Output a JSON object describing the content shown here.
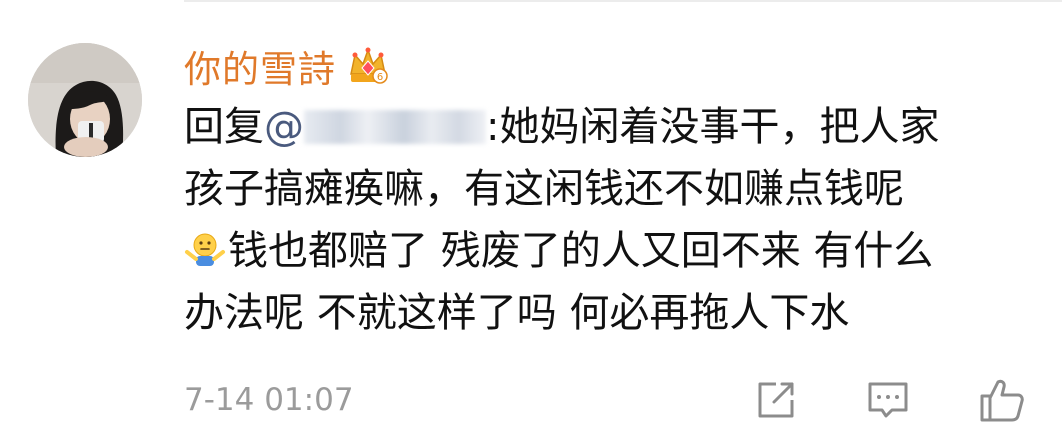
{
  "comment": {
    "username": "你的雪詩",
    "username_color": "#e0792a",
    "vip_badge_icon": "crown-vip-badge-icon",
    "reply_prefix": "回复",
    "mention_at": "@",
    "mention_redacted": true,
    "body_line_1": ":她妈闲着没事干，把人家",
    "body_line_2": "孩子搞瘫痪嘛，有这闲钱还不如赚点钱呢",
    "emoji_icon": "shrug-emoji-icon",
    "body_line_3": "钱也都赔了 残废了的人又回不来 有什么",
    "body_line_4": "办法呢 不就这样了吗 何必再拖人下水",
    "timestamp": "7-14 01:07"
  },
  "actions": {
    "share_icon": "share-icon",
    "reply_icon": "comment-icon",
    "like_icon": "thumbs-up-icon"
  }
}
